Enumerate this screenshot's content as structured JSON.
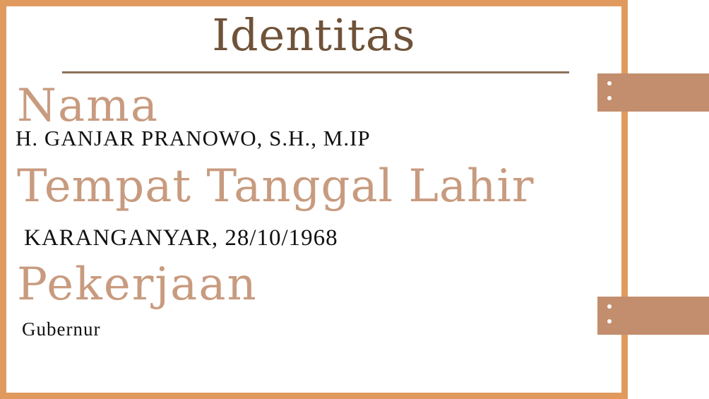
{
  "card": {
    "title": "Identitas",
    "fields": [
      {
        "label": "Nama",
        "value": "H. GANJAR PRANOWO, S.H., M.IP"
      },
      {
        "label": "Tempat Tanggal Lahir",
        "value": "KARANGANYAR, 28/10/1968"
      },
      {
        "label": "Pekerjaan",
        "value": "Gubernur"
      }
    ]
  },
  "colors": {
    "frame": "#e09a5d",
    "tab": "#c28e6d",
    "title": "#6f5238",
    "label": "#c89b7f",
    "value": "#111111"
  }
}
